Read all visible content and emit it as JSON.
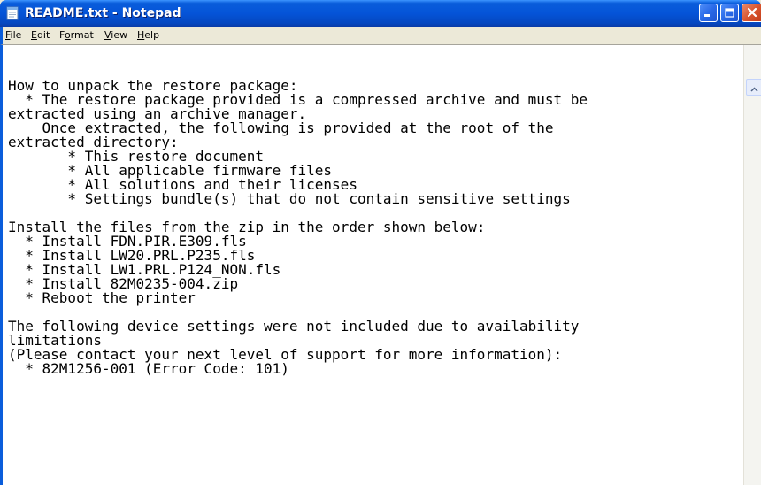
{
  "window": {
    "title": "README.txt - Notepad"
  },
  "menubar": {
    "items": [
      {
        "accel": "F",
        "rest": "ile"
      },
      {
        "accel": "E",
        "rest": "dit"
      },
      {
        "pre": "F",
        "accel": "o",
        "rest": "rmat"
      },
      {
        "accel": "V",
        "rest": "iew"
      },
      {
        "accel": "H",
        "rest": "elp"
      }
    ]
  },
  "document": {
    "lines": [
      "How to unpack the restore package:",
      "  * The restore package provided is a compressed archive and must be",
      "extracted using an archive manager.",
      "    Once extracted, the following is provided at the root of the",
      "extracted directory:",
      "       * This restore document",
      "       * All applicable firmware files",
      "       * All solutions and their licenses",
      "       * Settings bundle(s) that do not contain sensitive settings",
      "",
      "Install the files from the zip in the order shown below:",
      "  * Install FDN.PIR.E309.fls",
      "  * Install LW20.PRL.P235.fls",
      "  * Install LW1.PRL.P124_NON.fls",
      "  * Install 82M0235-004.zip",
      "  * Reboot the printer",
      "",
      "The following device settings were not included due to availability",
      "limitations",
      "(Please contact your next level of support for more information):",
      "  * 82M1256-001 (Error Code: 101)"
    ],
    "caret_line": 15
  },
  "icons": {
    "app": "notepad-icon",
    "minimize": "minimize-icon",
    "maximize": "maximize-icon",
    "close": "close-icon",
    "scroll_up": "scroll-up-arrow-icon"
  },
  "colors": {
    "titlebar": "#0554d8",
    "close_button": "#d9552f",
    "menubar_bg": "#ece9d8",
    "text": "#000000"
  }
}
